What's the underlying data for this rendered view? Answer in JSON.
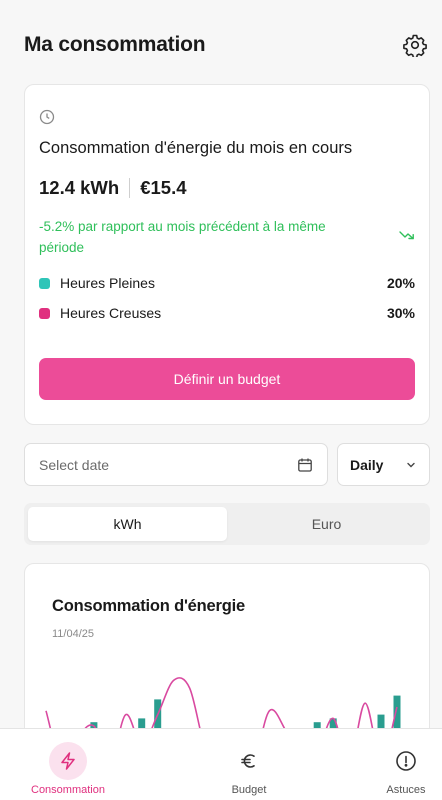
{
  "header": {
    "title": "Ma consommation",
    "settings_icon": "gear-icon"
  },
  "summary": {
    "clock_icon": "clock-icon",
    "title": "Consommation d'énergie du mois en cours",
    "kwh": "12.4 kWh",
    "euro": "€15.4",
    "delta_text": "-5.2% par rapport au mois précédent à la même période",
    "trend_icon": "trend-down-icon",
    "legend": [
      {
        "label": "Heures Pleines",
        "pct": "20%",
        "color": "#2fc5b8"
      },
      {
        "label": "Heures Creuses",
        "pct": "30%",
        "color": "#e0307f"
      }
    ],
    "budget_button": "Définir un budget"
  },
  "filters": {
    "date_placeholder": "Select date",
    "period": "Daily",
    "unit_tabs": [
      {
        "label": "kWh",
        "active": true
      },
      {
        "label": "Euro",
        "active": false
      }
    ]
  },
  "chart": {
    "title": "Consommation d'énergie",
    "date": "11/04/25"
  },
  "chart_data": {
    "type": "bar",
    "title": "Consommation d'énergie",
    "series": [
      {
        "type": "bar",
        "color": "#2a9d8f",
        "values": [
          0.9,
          0.1,
          0.0,
          1.1,
          0.0,
          0.0,
          1.2,
          1.7,
          0.0,
          0.0,
          0.0,
          0.0,
          0.0,
          0.2,
          0.8,
          0.7,
          0.6,
          1.1,
          1.2,
          0.0,
          0.8,
          1.3,
          1.8
        ]
      },
      {
        "type": "line",
        "color": "#d94aa0",
        "values": [
          1.4,
          0.0,
          0.7,
          1.0,
          0.0,
          1.3,
          0.5,
          1.3,
          2.2,
          2.0,
          0.4,
          0.0,
          0.0,
          0.0,
          1.4,
          0.9,
          0.0,
          0.3,
          1.2,
          0.0,
          1.6,
          0.1,
          1.5
        ]
      }
    ],
    "grid": false,
    "legend": "none"
  },
  "nav": [
    {
      "label": "Consommation",
      "icon": "lightning-icon",
      "active": true
    },
    {
      "label": "Budget",
      "icon": "euro-icon",
      "active": false
    },
    {
      "label": "Astuces",
      "icon": "info-icon",
      "active": false
    }
  ]
}
